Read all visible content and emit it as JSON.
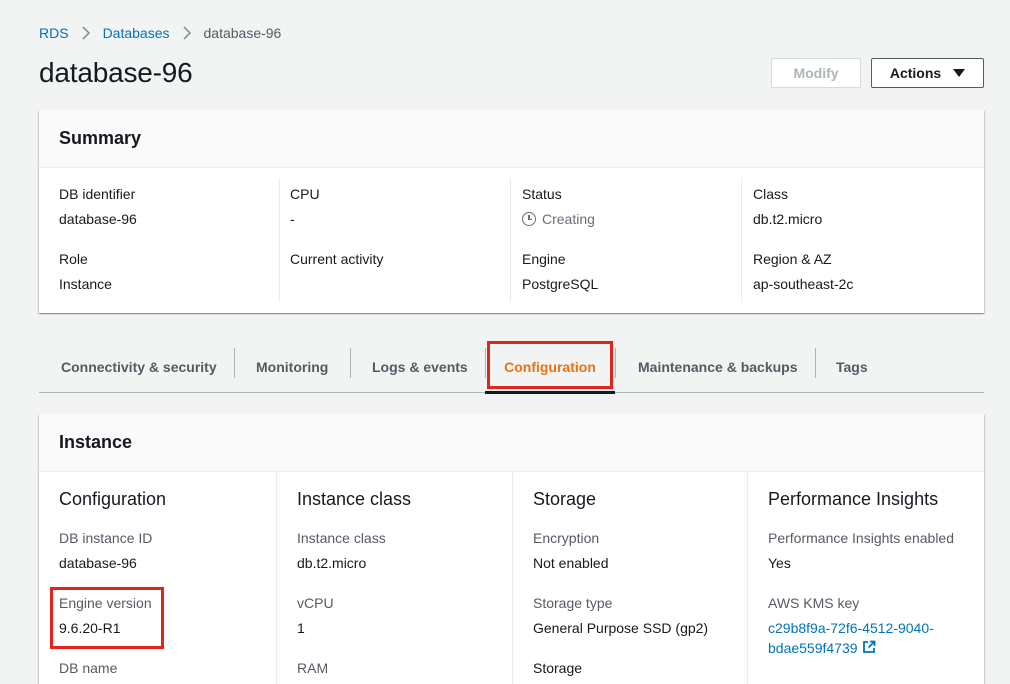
{
  "breadcrumb": {
    "items": [
      "RDS",
      "Databases"
    ],
    "current": "database-96"
  },
  "page": {
    "title": "database-96"
  },
  "header_buttons": {
    "modify": "Modify",
    "actions": "Actions"
  },
  "summary": {
    "title": "Summary",
    "fields": {
      "db_identifier": {
        "label": "DB identifier",
        "value": "database-96"
      },
      "role": {
        "label": "Role",
        "value": "Instance"
      },
      "cpu": {
        "label": "CPU",
        "value": "-"
      },
      "current_activity": {
        "label": "Current activity",
        "value": ""
      },
      "status": {
        "label": "Status",
        "value": "Creating"
      },
      "engine": {
        "label": "Engine",
        "value": "PostgreSQL"
      },
      "class": {
        "label": "Class",
        "value": "db.t2.micro"
      },
      "region_az": {
        "label": "Region & AZ",
        "value": "ap-southeast-2c"
      }
    }
  },
  "tabs": [
    "Connectivity & security",
    "Monitoring",
    "Logs & events",
    "Configuration",
    "Maintenance & backups",
    "Tags"
  ],
  "active_tab": "Configuration",
  "instance": {
    "title": "Instance",
    "configuration": {
      "title": "Configuration",
      "db_instance_id": {
        "label": "DB instance ID",
        "value": "database-96"
      },
      "engine_version": {
        "label": "Engine version",
        "value": "9.6.20-R1"
      },
      "db_name": {
        "label": "DB name"
      }
    },
    "instance_class": {
      "title": "Instance class",
      "instance_class": {
        "label": "Instance class",
        "value": "db.t2.micro"
      },
      "vcpu": {
        "label": "vCPU",
        "value": "1"
      },
      "ram": {
        "label": "RAM"
      }
    },
    "storage": {
      "title": "Storage",
      "encryption": {
        "label": "Encryption",
        "value": "Not enabled"
      },
      "storage_type": {
        "label": "Storage type",
        "value": "General Purpose SSD (gp2)"
      },
      "storage": {
        "label": "Storage"
      }
    },
    "performance_insights": {
      "title": "Performance Insights",
      "enabled": {
        "label": "Performance Insights enabled",
        "value": "Yes"
      },
      "kms_key": {
        "label": "AWS KMS key",
        "value": "c29b8f9a-72f6-4512-9040-bdae559f4739"
      }
    }
  },
  "colors": {
    "link": "#0073bb",
    "active_tab": "#ec7211",
    "highlight": "#e0261b"
  }
}
